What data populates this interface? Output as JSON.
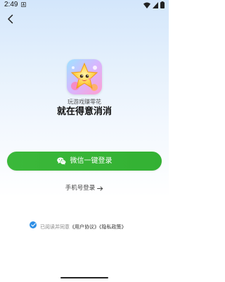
{
  "status_bar": {
    "time": "2:49"
  },
  "icons": {
    "back": "chevron-left-icon",
    "status_app": "a-icon",
    "wifi": "wifi-icon",
    "signal": "signal-icon",
    "battery": "battery-icon",
    "wechat": "wechat-icon",
    "arrow": "arrow-right-icon",
    "check": "check-circle-icon"
  },
  "hero": {
    "slogan_small": "玩游戏赚零花",
    "slogan_large": "就在得意消消"
  },
  "actions": {
    "wechat_login_label": "微信一键登录",
    "phone_login_label": "手机号登录"
  },
  "agreement": {
    "prefix": "已阅读并同意",
    "user_agreement": "《用户协议》",
    "privacy_policy": "《隐私政策》"
  },
  "colors": {
    "primary_green": "#35b334",
    "check_blue": "#2e8fe6",
    "background_top": "#d3e6fb"
  }
}
